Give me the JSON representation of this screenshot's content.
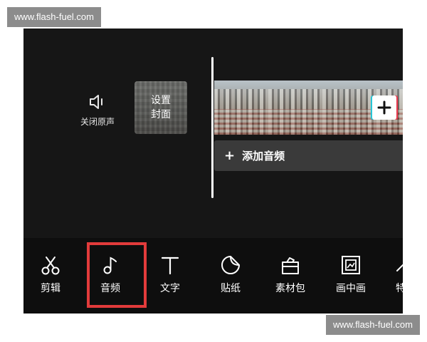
{
  "watermark": {
    "text": "www.flash-fuel.com"
  },
  "editor": {
    "mute": {
      "label": "关闭原声",
      "icon": "speaker-off-icon"
    },
    "cover": {
      "label": "设置封面"
    },
    "timeline": {
      "add_clip_icon": "plus-icon",
      "add_audio_label": "添加音频",
      "add_audio_icon": "plus-icon"
    }
  },
  "toolbar": {
    "items": [
      {
        "label": "剪辑",
        "icon": "scissors-icon"
      },
      {
        "label": "音频",
        "icon": "music-note-icon",
        "highlighted": true
      },
      {
        "label": "文字",
        "icon": "text-icon"
      },
      {
        "label": "贴纸",
        "icon": "sticker-icon"
      },
      {
        "label": "素材包",
        "icon": "material-pack-icon"
      },
      {
        "label": "画中画",
        "icon": "picture-in-picture-icon"
      },
      {
        "label": "特",
        "icon": "more-icon"
      }
    ]
  },
  "colors": {
    "background": "#161616",
    "toolbar_bg": "#0e0e0e",
    "highlight": "#e23b3b",
    "add_audio_bg": "#3a3a3a"
  }
}
